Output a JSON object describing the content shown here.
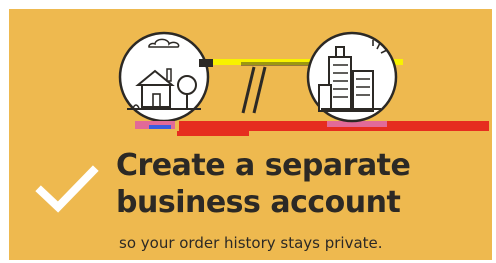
{
  "colors": {
    "background": "#eeb94f",
    "text": "#2c2925",
    "check": "#ffffff",
    "accent_red": "#e62d1f",
    "accent_pink": "#e26a98",
    "accent_yellow": "#f8f200"
  },
  "illustration": {
    "left_icon": "house-icon",
    "divider": "slash-divider",
    "right_icon": "office-buildings-icon"
  },
  "check_icon": "checkmark-icon",
  "headline": {
    "line1": "Create a separate",
    "line2": "business account"
  },
  "subline": "so your order history stays private."
}
